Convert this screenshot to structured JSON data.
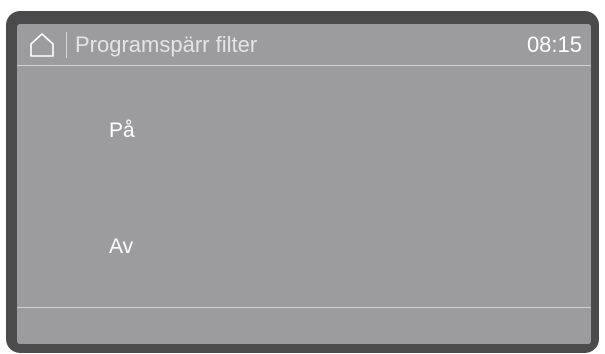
{
  "header": {
    "icon": "home-icon",
    "title": "Programspärr filter",
    "time": "08:15"
  },
  "options": [
    {
      "label": "På"
    },
    {
      "label": "Av"
    }
  ],
  "colors": {
    "bezel": "#4b4b4c",
    "screen": "#9c9c9e",
    "text": "#ffffff",
    "divider": "#d2d2d2"
  }
}
